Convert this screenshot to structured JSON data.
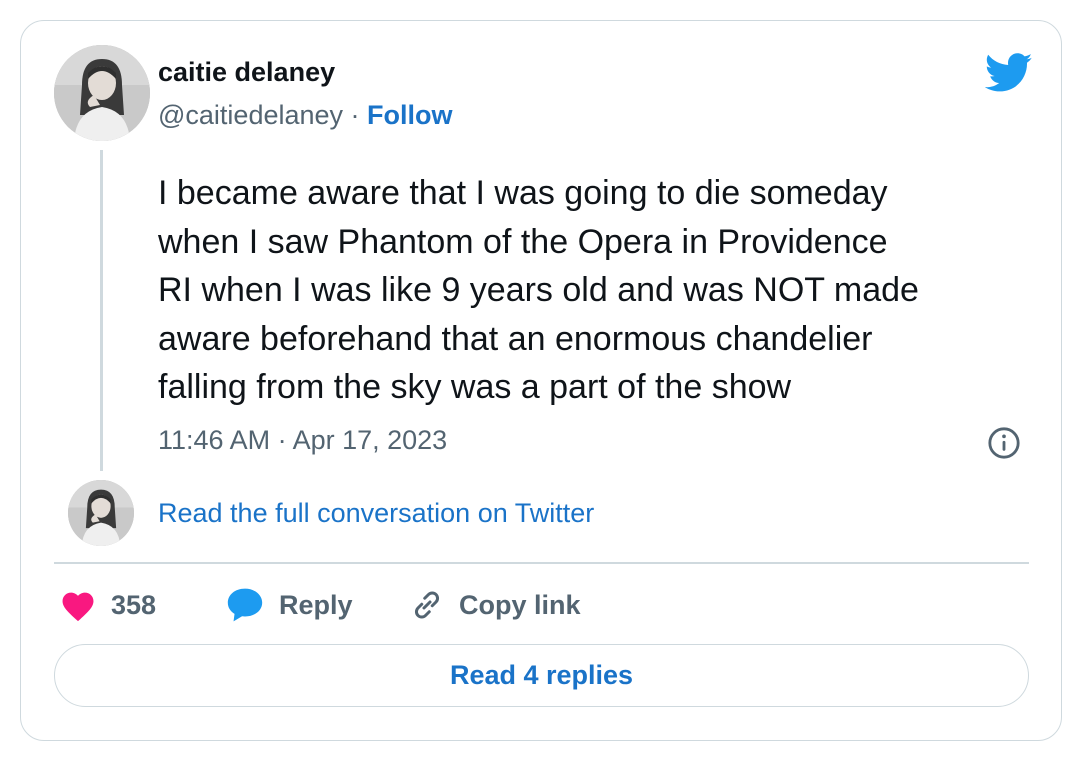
{
  "author": {
    "name": "caitie delaney",
    "handle": "@caitiedelaney",
    "separator": " · ",
    "follow_label": "Follow"
  },
  "tweet": {
    "text": "I became aware that I was going to die someday\nwhen I saw Phantom of the Opera in Providence\nRI when I was like 9 years old and was NOT made\naware beforehand that an enormous chandelier\nfalling from the sky was a part of the show",
    "timestamp": "11:46 AM · Apr 17, 2023"
  },
  "conversation": {
    "read_full_label": "Read the full conversation on Twitter"
  },
  "actions": {
    "likes_count": "358",
    "reply_label": "Reply",
    "copy_link_label": "Copy link"
  },
  "replies": {
    "read_replies_label": "Read 4 replies"
  },
  "icons": {
    "brand": "twitter-bird-icon",
    "info": "info-icon",
    "like": "heart-icon",
    "reply": "speech-bubble-icon",
    "copy": "link-icon"
  },
  "colors": {
    "twitter_blue": "#1d9bf0",
    "link_blue": "#1a73c8",
    "heart_pink": "#f91880",
    "text_primary": "#0f1419",
    "text_secondary": "#536471",
    "border": "#cfd9de"
  }
}
